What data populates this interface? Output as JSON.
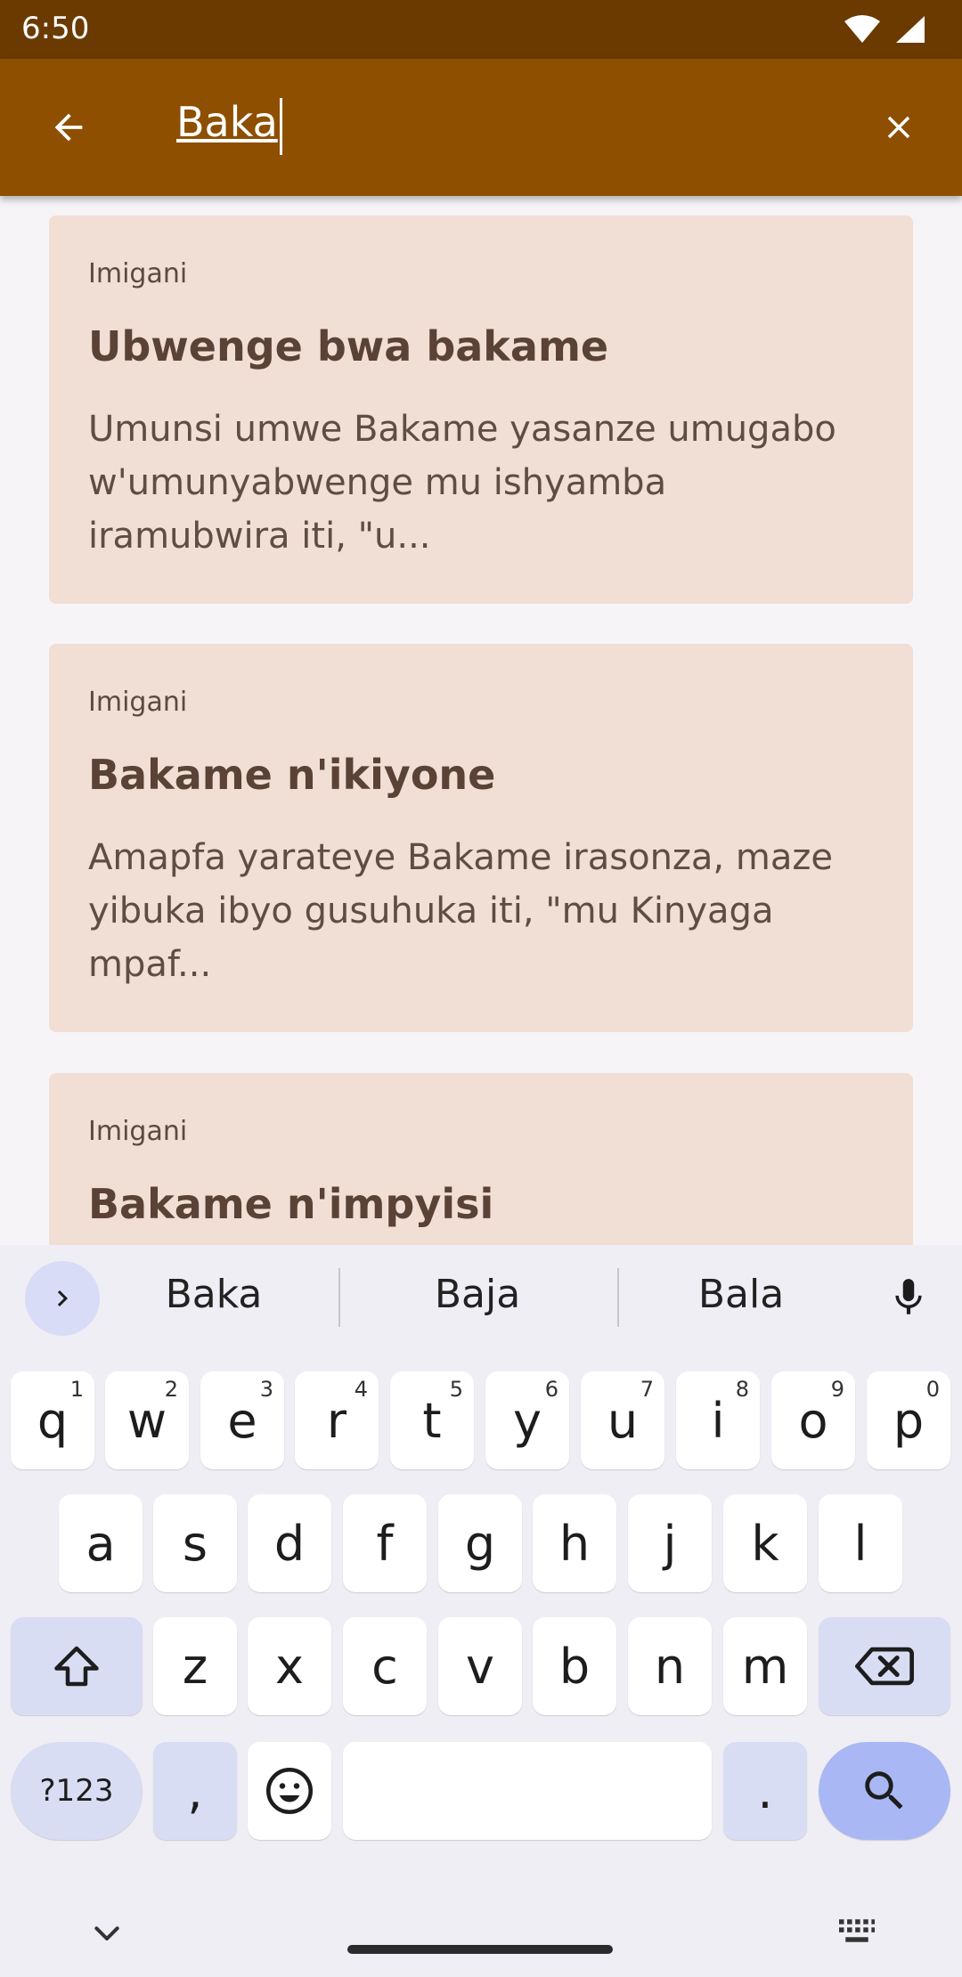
{
  "status": {
    "time": "6:50"
  },
  "appbar": {
    "query": "Baka"
  },
  "results": [
    {
      "category": "Imigani",
      "title": "Ubwenge bwa bakame",
      "excerpt": "Umunsi umwe Bakame yasanze umugabo w'umunyabwenge mu ishyamba iramubwira iti, \"u..."
    },
    {
      "category": "Imigani",
      "title": "Bakame n'ikiyone",
      "excerpt": "Amapfa yarateye Bakame irasonza, maze yibuka ibyo gusuhuka iti, \"mu Kinyaga mpaf..."
    },
    {
      "category": "Imigani",
      "title": "Bakame n'impyisi",
      "excerpt": ""
    }
  ],
  "keyboard": {
    "suggestions": [
      "Baka",
      "Baja",
      "Bala"
    ],
    "row1": [
      {
        "k": "q",
        "h": "1"
      },
      {
        "k": "w",
        "h": "2"
      },
      {
        "k": "e",
        "h": "3"
      },
      {
        "k": "r",
        "h": "4"
      },
      {
        "k": "t",
        "h": "5"
      },
      {
        "k": "y",
        "h": "6"
      },
      {
        "k": "u",
        "h": "7"
      },
      {
        "k": "i",
        "h": "8"
      },
      {
        "k": "o",
        "h": "9"
      },
      {
        "k": "p",
        "h": "0"
      }
    ],
    "row2": [
      "a",
      "s",
      "d",
      "f",
      "g",
      "h",
      "j",
      "k",
      "l"
    ],
    "row3": [
      "z",
      "x",
      "c",
      "v",
      "b",
      "n",
      "m"
    ],
    "numbers_label": "?123",
    "comma": ",",
    "period": "."
  }
}
